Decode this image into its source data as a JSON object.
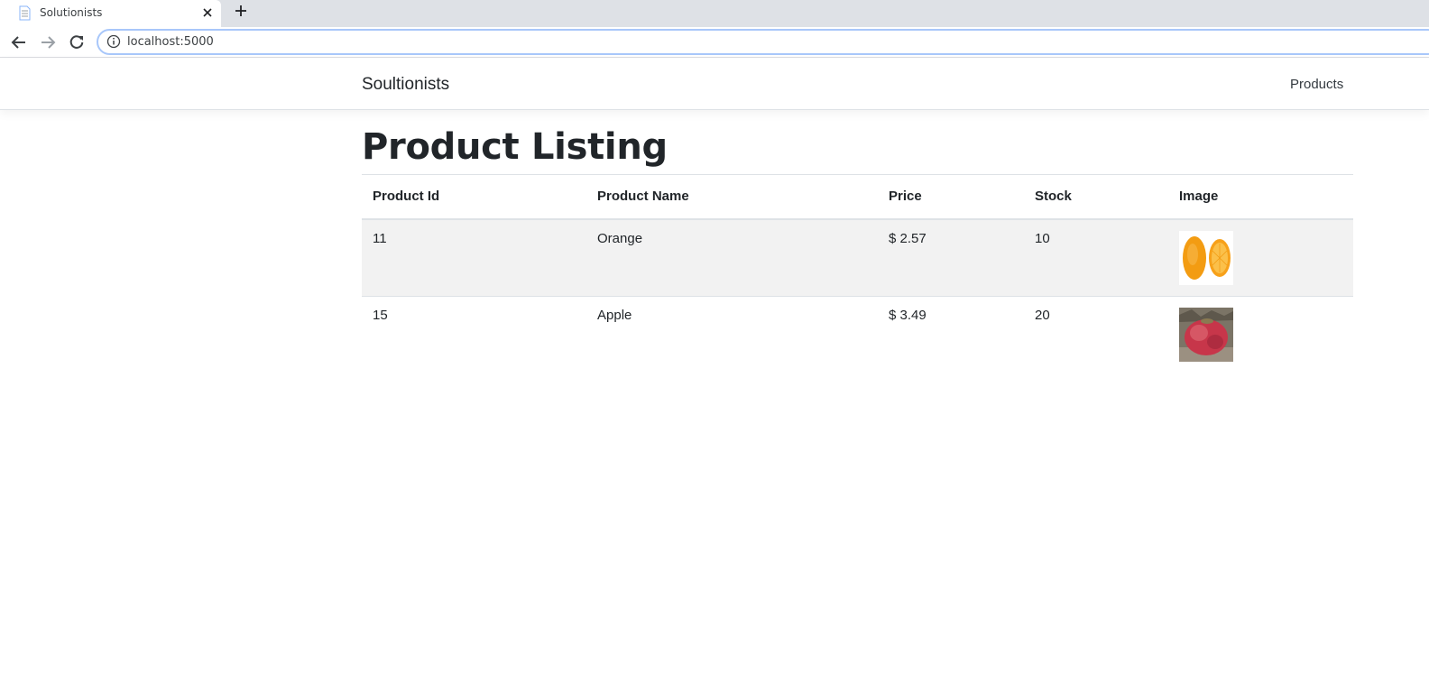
{
  "browser": {
    "tab_title": "Solutionists",
    "url": "localhost:5000"
  },
  "navbar": {
    "brand": "Soultionists",
    "links": [
      {
        "label": "Products"
      }
    ]
  },
  "main": {
    "title": "Product Listing",
    "table": {
      "headers": [
        "Product Id",
        "Product Name",
        "Price",
        "Stock",
        "Image"
      ],
      "rows": [
        {
          "id": "11",
          "name": "Orange",
          "price": "$ 2.57",
          "stock": "10",
          "image_icon": "orange-image"
        },
        {
          "id": "15",
          "name": "Apple",
          "price": "$ 3.49",
          "stock": "20",
          "image_icon": "apple-image"
        }
      ]
    }
  },
  "colors": {
    "text": "#212529",
    "stripe": "#f2f2f2",
    "border": "#dee2e6",
    "tabstrip": "#dee1e6",
    "omnibox_focus": "#a8c7fa"
  }
}
